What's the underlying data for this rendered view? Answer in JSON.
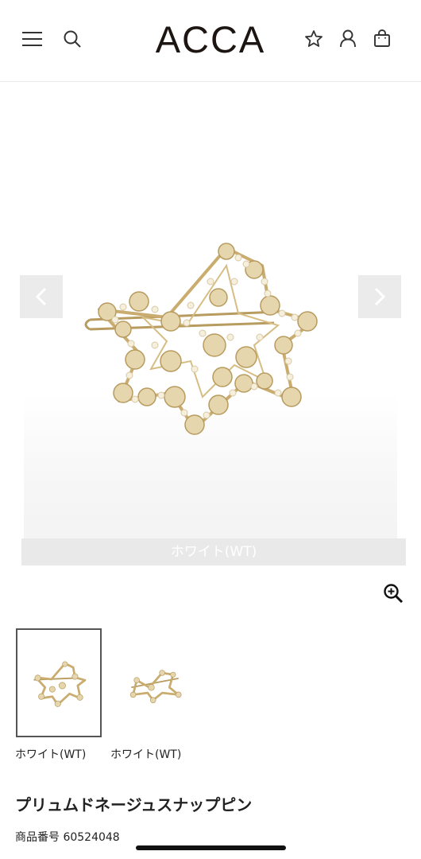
{
  "header": {
    "logo": "ACCA",
    "icons": [
      "menu-icon",
      "search-icon",
      "star-icon",
      "user-icon",
      "bag-icon"
    ]
  },
  "gallery": {
    "color_label": "ホワイト(WT)",
    "prev_icon": "chevron-left-icon",
    "next_icon": "chevron-right-icon",
    "zoom_icon": "zoom-in-icon"
  },
  "thumbnails": [
    {
      "label": "ホワイト(WT)",
      "selected": true
    },
    {
      "label": "ホワイト(WT)",
      "selected": false
    }
  ],
  "product": {
    "name": "プリュムドネージュスナップピン",
    "code": "商品番号 60524048"
  },
  "colors": {
    "gold": "#c9ac6e",
    "pearl": "#f3ecd8",
    "text": "#222222"
  }
}
